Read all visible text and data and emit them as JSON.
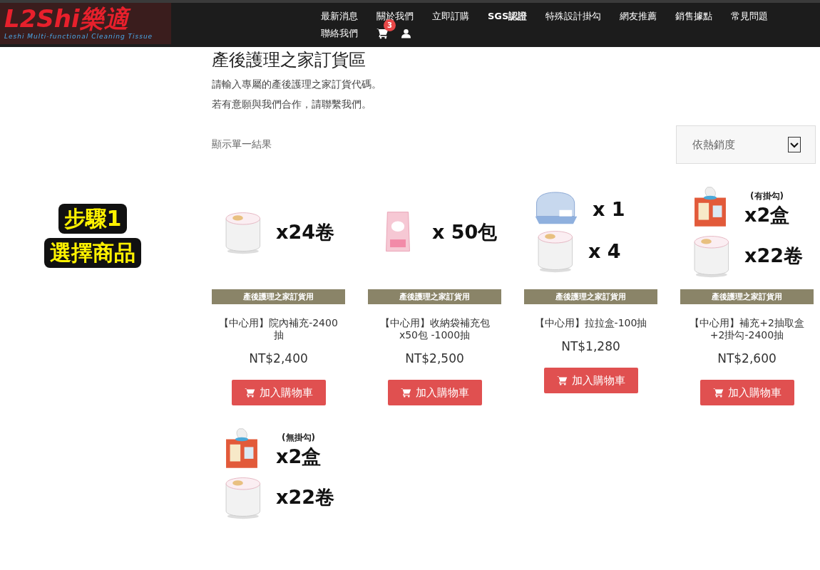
{
  "header": {
    "logo": {
      "text": "L2Shi樂適",
      "tagline": "Leshi Multi-functional Cleaning Tissue"
    },
    "nav": [
      {
        "label": "最新消息",
        "bold": false
      },
      {
        "label": "關於我們",
        "bold": false
      },
      {
        "label": "立即訂購",
        "bold": false
      },
      {
        "label": "SGS認證",
        "bold": true
      },
      {
        "label": "特殊設計掛勾",
        "bold": false
      },
      {
        "label": "網友推薦",
        "bold": false
      },
      {
        "label": "銷售據點",
        "bold": false
      },
      {
        "label": "常見問題",
        "bold": false
      },
      {
        "label": "聯絡我們",
        "bold": false
      }
    ],
    "cart_count": "3"
  },
  "step": {
    "title": "步驟1",
    "subtitle": "選擇商品"
  },
  "page": {
    "title": "產後護理之家訂貨區",
    "intro": [
      "請輸入專屬的產後護理之家訂貨代碼。",
      "若有意願與我們合作，請聯繫我們。"
    ],
    "result_count": "顯示單一結果",
    "sort": {
      "value": "依熱銷度"
    }
  },
  "products": [
    {
      "image": [
        {
          "kind": "roll",
          "quantity": "x24卷"
        }
      ],
      "tag": "產後護理之家訂貨用",
      "name": "【中心用】院內補充-2400抽",
      "price": "NT$2,400",
      "button": "加入購物車"
    },
    {
      "image": [
        {
          "kind": "bag",
          "quantity": "x 50包"
        }
      ],
      "tag": "產後護理之家訂貨用",
      "name": "【中心用】收納袋補充包x50包 -1000抽",
      "price": "NT$2,500",
      "button": "加入購物車"
    },
    {
      "image": [
        {
          "kind": "dispenser",
          "quantity": "x 1"
        },
        {
          "kind": "roll",
          "quantity": "x 4"
        }
      ],
      "tag": "產後護理之家訂貨用",
      "name": "【中心用】拉拉盒-100抽",
      "price": "NT$1,280",
      "button": "加入購物車"
    },
    {
      "image": [
        {
          "kind": "box",
          "quantity": "x2盒",
          "note": "(有掛勾)"
        },
        {
          "kind": "roll",
          "quantity": "x22卷"
        }
      ],
      "tag": "產後護理之家訂貨用",
      "name": "【中心用】補充+2抽取盒+2掛勾-2400抽",
      "price": "NT$2,600",
      "button": "加入購物車"
    },
    {
      "image": [
        {
          "kind": "box",
          "quantity": "x2盒",
          "note": "(無掛勾)"
        },
        {
          "kind": "roll",
          "quantity": "x22卷"
        }
      ]
    }
  ]
}
